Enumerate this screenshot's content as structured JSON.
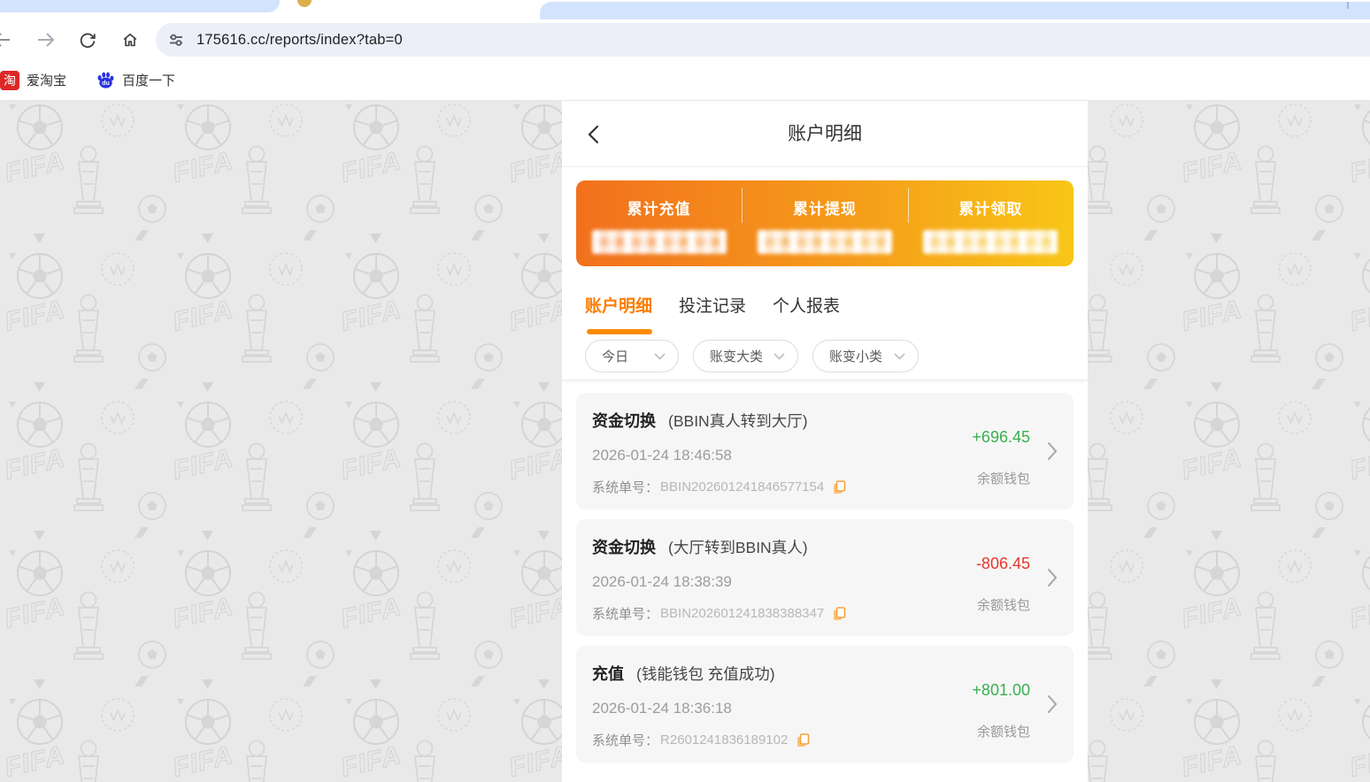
{
  "browser": {
    "toolbar": {
      "url": "175616.cc/reports/index?tab=0"
    },
    "bookmarks": {
      "items": [
        {
          "label": "爱淘宝",
          "icon": "taobao-icon",
          "icon_glyph": "淘",
          "icon_color": "#dd2727"
        },
        {
          "label": "百度一下",
          "icon": "baidu-paw-icon",
          "icon_color": "#2932e1"
        }
      ]
    }
  },
  "page": {
    "header": {
      "title": "账户明细",
      "back_icon": "chevron-left"
    },
    "summary": {
      "gradient": [
        "#f2701d",
        "#f8c617"
      ],
      "columns": [
        {
          "label": "累计充值",
          "value_hidden": true
        },
        {
          "label": "累计提现",
          "value_hidden": true
        },
        {
          "label": "累计领取",
          "value_hidden": true
        }
      ]
    },
    "tabs": {
      "active_color": "#fe7d00",
      "items": [
        {
          "label": "账户明细",
          "active": true
        },
        {
          "label": "投注记录",
          "active": false
        },
        {
          "label": "个人报表",
          "active": false
        }
      ]
    },
    "filters": {
      "items": [
        {
          "label": "今日"
        },
        {
          "label": "账变大类"
        },
        {
          "label": "账变小类"
        }
      ]
    },
    "records": {
      "order_label": "系统单号：",
      "items": [
        {
          "type": "资金切换",
          "subtitle": "(BBIN真人转到大厅)",
          "datetime": "2026-01-24 18:46:58",
          "order_no": "BBIN202601241846577154",
          "amount": "+696.45",
          "amount_color": "#3aaf4f",
          "wallet": "余额钱包"
        },
        {
          "type": "资金切换",
          "subtitle": "(大厅转到BBIN真人)",
          "datetime": "2026-01-24 18:38:39",
          "order_no": "BBIN202601241838388347",
          "amount": "-806.45",
          "amount_color": "#e6372e",
          "wallet": "余额钱包"
        },
        {
          "type": "充值",
          "subtitle": "(钱能钱包 充值成功)",
          "datetime": "2026-01-24 18:36:18",
          "order_no": "R2601241836189102",
          "amount": "+801.00",
          "amount_color": "#3aaf4f",
          "wallet": "余额钱包"
        }
      ]
    },
    "colors": {
      "positive": "#3aaf4f",
      "negative": "#e6372e",
      "accent_orange": "#fe7d00",
      "copy_icon": "#f7a13c",
      "background": "#e9e9e9",
      "pattern": "#d8d8d8"
    }
  }
}
